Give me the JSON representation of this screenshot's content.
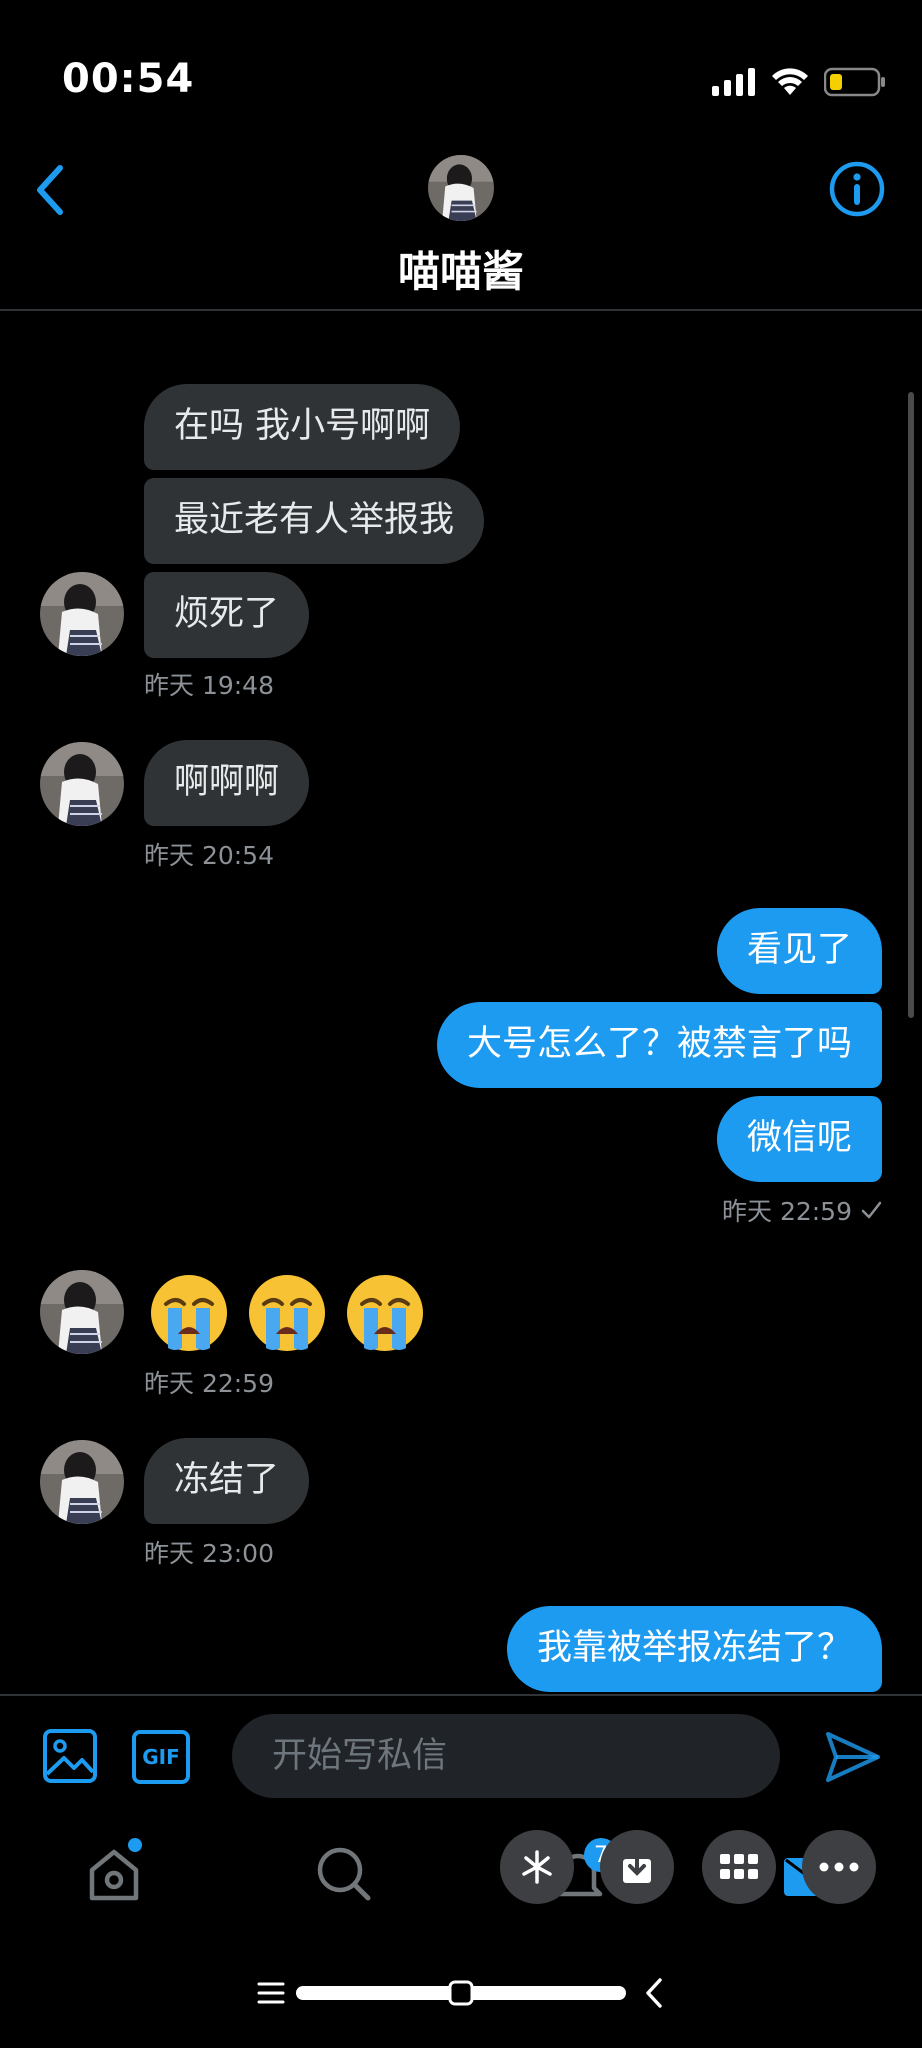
{
  "status_bar": {
    "time": "00:54",
    "battery_color": "#f4d000"
  },
  "header": {
    "contact_name": "喵喵酱"
  },
  "messages": [
    {
      "from": "them",
      "text": "在吗 我小号啊啊"
    },
    {
      "from": "them",
      "text": "最近老有人举报我"
    },
    {
      "from": "them",
      "text": "烦死了"
    },
    {
      "from": "them",
      "timestamp": "昨天 19:48"
    },
    {
      "from": "them",
      "text": "啊啊啊"
    },
    {
      "from": "them",
      "timestamp": "昨天 20:54"
    },
    {
      "from": "me",
      "text": "看见了"
    },
    {
      "from": "me",
      "text": "大号怎么了？被禁言了吗"
    },
    {
      "from": "me",
      "text": "微信呢"
    },
    {
      "from": "me",
      "timestamp": "昨天 22:59"
    },
    {
      "from": "them",
      "text": "😭😭😭"
    },
    {
      "from": "them",
      "timestamp": "昨天 22:59"
    },
    {
      "from": "them",
      "text": "冻结了"
    },
    {
      "from": "them",
      "timestamp": "昨天 23:00"
    },
    {
      "from": "me",
      "text": "我靠被举报冻结了？"
    }
  ],
  "composer": {
    "placeholder": "开始写私信",
    "gif_label": "GIF"
  },
  "tabbar": {
    "notification_badge": "7"
  },
  "colors": {
    "accent": "#1d9bf0",
    "incoming_bubble": "#2f3336",
    "background": "#000000"
  }
}
